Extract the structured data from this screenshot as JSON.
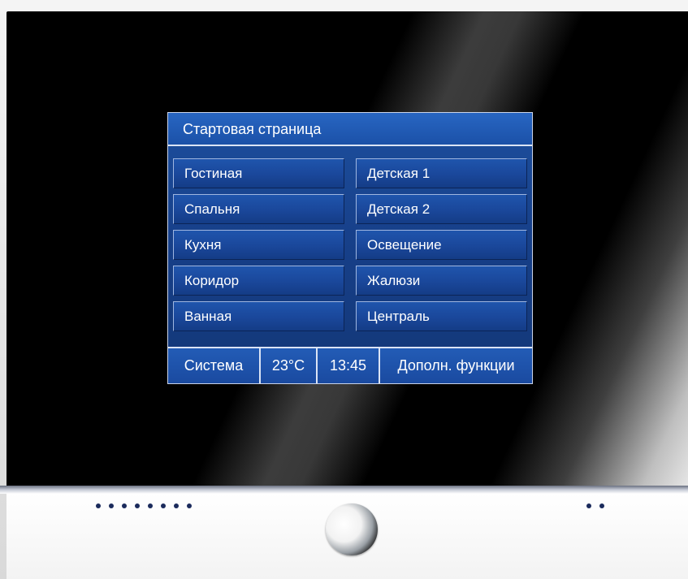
{
  "screen": {
    "title": "Стартовая страница",
    "rooms_left": [
      "Гостиная",
      "Спальня",
      "Кухня",
      "Коридор",
      "Ванная"
    ],
    "rooms_right": [
      "Детская 1",
      "Детская 2",
      "Освещение",
      "Жалюзи",
      "Централь"
    ],
    "status": {
      "system": "Система",
      "temperature": "23°C",
      "time": "13:45",
      "extra": "Дополн. функции"
    }
  },
  "colors": {
    "panel_blue": "#1a479a",
    "bezel": "#000000",
    "led": "#1b2b5c"
  }
}
